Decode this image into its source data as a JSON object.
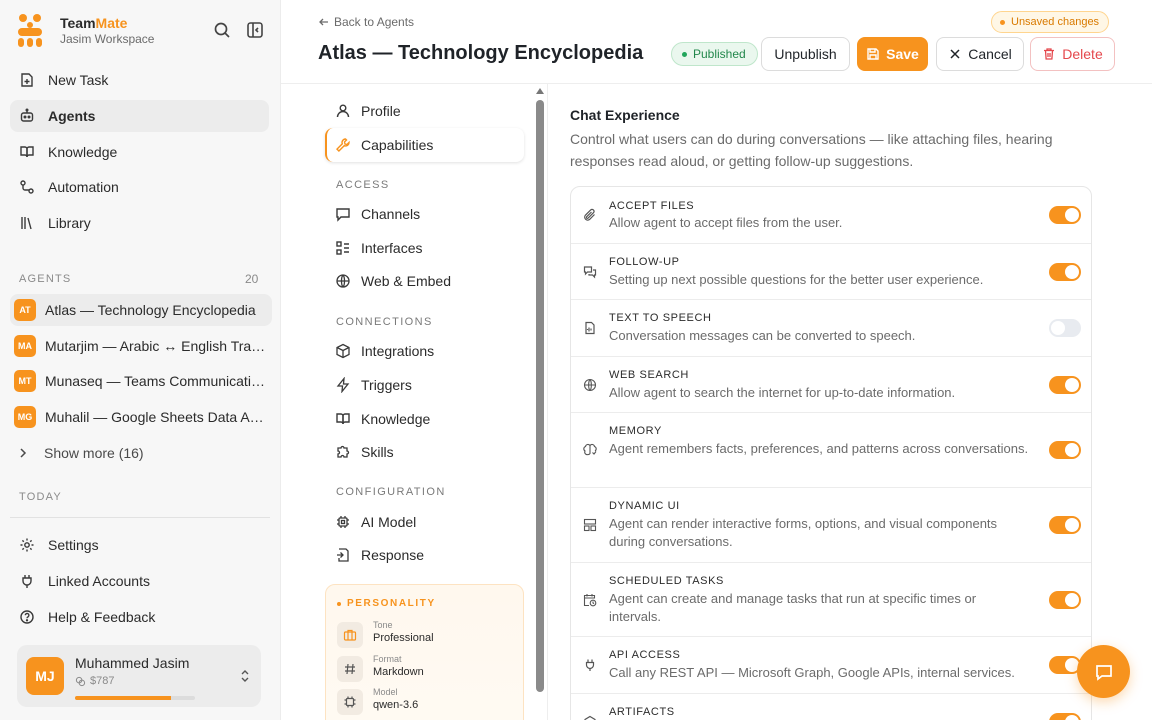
{
  "brand": {
    "name_a": "Team",
    "name_b": "Mate",
    "workspace": "Jasim Workspace",
    "accent": "#f7931e"
  },
  "sidebar": {
    "nav": [
      {
        "label": "New Task",
        "icon": "new-task-icon"
      },
      {
        "label": "Agents",
        "icon": "agents-icon",
        "active": true
      },
      {
        "label": "Knowledge",
        "icon": "book-icon"
      },
      {
        "label": "Automation",
        "icon": "workflow-icon"
      },
      {
        "label": "Library",
        "icon": "library-icon"
      }
    ],
    "agents_label": "AGENTS",
    "agents_count": "20",
    "agents": [
      {
        "initials": "AT",
        "label": "Atlas — Technology Encyclopedia",
        "active": true
      },
      {
        "initials": "MA",
        "label": "Mutarjim — Arabic ↔ English Translator"
      },
      {
        "initials": "MT",
        "label": "Munaseq — Teams Communications"
      },
      {
        "initials": "MG",
        "label": "Muhalil — Google Sheets Data Analyst"
      }
    ],
    "show_more": "Show more (16)",
    "today_label": "TODAY",
    "bottom": [
      {
        "label": "Settings",
        "icon": "gear-icon"
      },
      {
        "label": "Linked Accounts",
        "icon": "plug-icon"
      },
      {
        "label": "Help & Feedback",
        "icon": "help-icon"
      }
    ],
    "user": {
      "initials": "MJ",
      "name": "Muhammed Jasim",
      "credit": "$787",
      "usage_fraction": 0.8
    }
  },
  "header": {
    "back": "Back to Agents",
    "title": "Atlas — Technology Encyclopedia",
    "unsaved": "Unsaved changes",
    "status": "Published",
    "unpublish": "Unpublish",
    "save": "Save",
    "cancel": "Cancel",
    "delete": "Delete"
  },
  "settings_nav": {
    "top": [
      {
        "label": "Profile",
        "icon": "user-icon"
      },
      {
        "label": "Capabilities",
        "icon": "wrench-icon",
        "active": true
      }
    ],
    "sections": [
      {
        "label": "ACCESS",
        "items": [
          {
            "label": "Channels",
            "icon": "chat-icon"
          },
          {
            "label": "Interfaces",
            "icon": "interfaces-icon"
          },
          {
            "label": "Web & Embed",
            "icon": "globe-icon"
          }
        ]
      },
      {
        "label": "CONNECTIONS",
        "items": [
          {
            "label": "Integrations",
            "icon": "box-icon"
          },
          {
            "label": "Triggers",
            "icon": "bolt-icon"
          },
          {
            "label": "Knowledge",
            "icon": "book-icon"
          },
          {
            "label": "Skills",
            "icon": "puzzle-icon"
          }
        ]
      },
      {
        "label": "CONFIGURATION",
        "items": [
          {
            "label": "AI Model",
            "icon": "chip-icon"
          },
          {
            "label": "Response",
            "icon": "response-icon"
          }
        ]
      }
    ],
    "personality": {
      "title": "PERSONALITY",
      "rows": [
        {
          "label": "Tone",
          "value": "Professional",
          "icon": "briefcase-icon"
        },
        {
          "label": "Format",
          "value": "Markdown",
          "icon": "hash-icon"
        },
        {
          "label": "Model",
          "value": "qwen-3.6",
          "icon": "chip-icon"
        }
      ]
    }
  },
  "content": {
    "title": "Chat Experience",
    "description": "Control what users can do during conversations — like attaching files, hearing responses read aloud, or getting follow-up suggestions.",
    "capabilities": [
      {
        "name": "ACCEPT FILES",
        "desc": "Allow agent to accept files from the user.",
        "enabled": true,
        "icon": "paperclip-icon"
      },
      {
        "name": "FOLLOW-UP",
        "desc": "Setting up next possible questions for the better user experience.",
        "enabled": true,
        "icon": "chat-bubbles-icon"
      },
      {
        "name": "TEXT TO SPEECH",
        "desc": "Conversation messages can be converted to speech.",
        "enabled": false,
        "icon": "file-audio-icon"
      },
      {
        "name": "WEB SEARCH",
        "desc": "Allow agent to search the internet for up-to-date information.",
        "enabled": true,
        "icon": "globe-icon"
      },
      {
        "name": "MEMORY",
        "desc": "Agent remembers facts, preferences, and patterns across conversations.",
        "enabled": true,
        "icon": "brain-icon"
      },
      {
        "name": "DYNAMIC UI",
        "desc": "Agent can render interactive forms, options, and visual components during conversations.",
        "enabled": true,
        "icon": "layout-icon"
      },
      {
        "name": "SCHEDULED TASKS",
        "desc": "Agent can create and manage tasks that run at specific times or intervals.",
        "enabled": true,
        "icon": "calendar-clock-icon"
      },
      {
        "name": "API ACCESS",
        "desc": "Call any REST API — Microsoft Graph, Google APIs, internal services.",
        "enabled": true,
        "icon": "plug-icon"
      },
      {
        "name": "ARTIFACTS",
        "desc": "",
        "enabled": true,
        "icon": "artifact-icon"
      }
    ]
  },
  "fab": {
    "icon": "chat-icon"
  }
}
